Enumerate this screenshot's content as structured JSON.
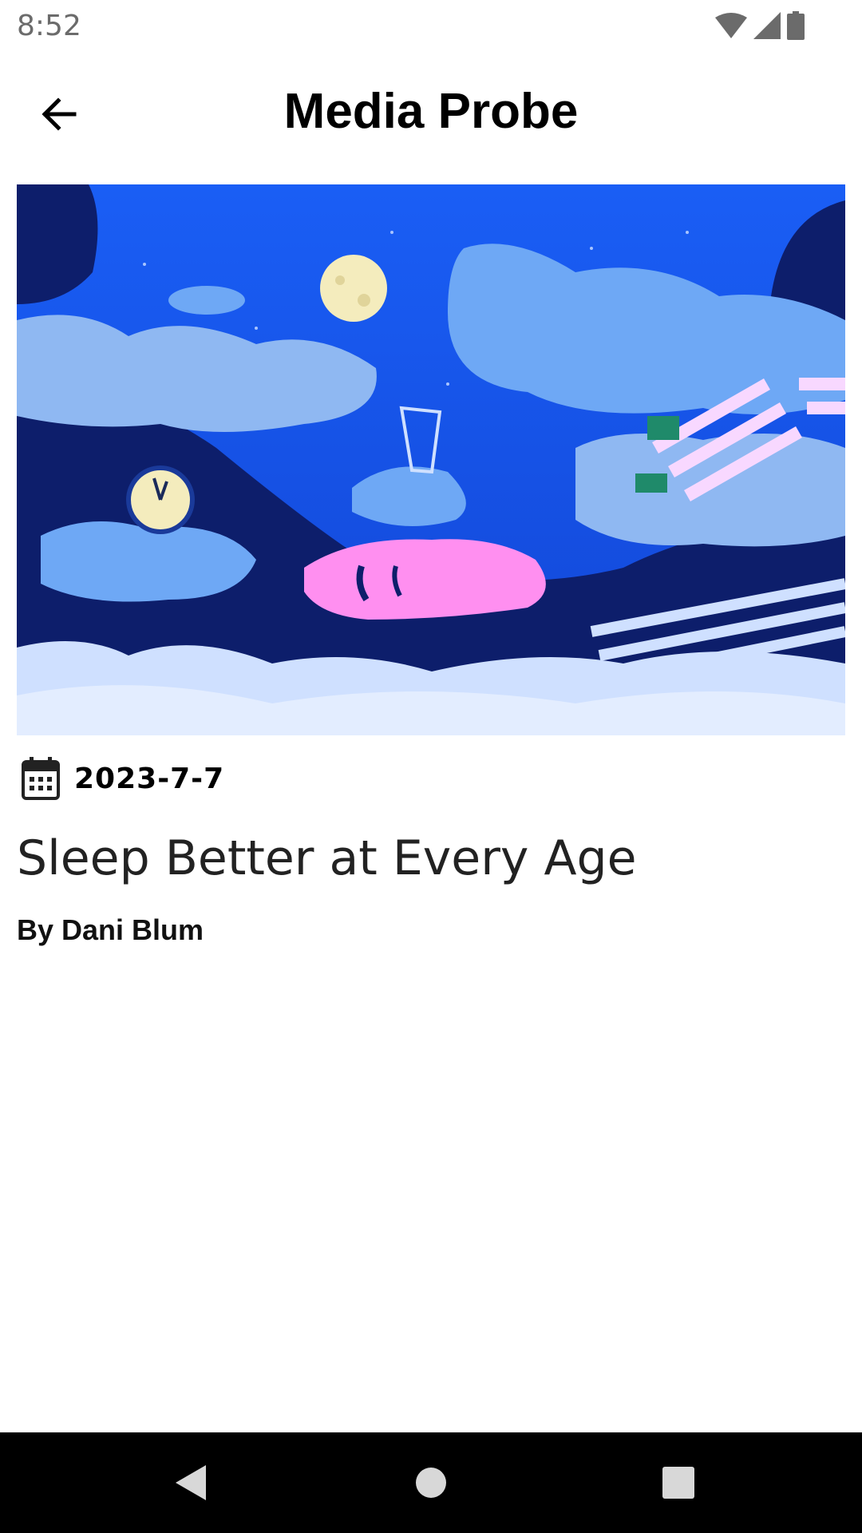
{
  "status_bar": {
    "time": "8:52",
    "icons": [
      "wifi-icon",
      "signal-icon",
      "battery-icon"
    ]
  },
  "app_bar": {
    "title": "Media Probe",
    "back_icon": "arrow-back-icon"
  },
  "article": {
    "image_description_icon": "sleep-illustration",
    "date_icon": "calendar-icon",
    "date": "2023-7-7",
    "title": "Sleep Better at Every Age",
    "byline": "By Dani Blum"
  },
  "nav_bar": {
    "icons": [
      "back-triangle-icon",
      "home-circle-icon",
      "recents-square-icon"
    ]
  },
  "colors": {
    "nav_background": "#000000",
    "illustration_sky": "#1565f0",
    "illustration_night": "#0d1e6b",
    "illustration_cloud": "#8fb8f2",
    "illustration_face": "#ff8ff0"
  }
}
